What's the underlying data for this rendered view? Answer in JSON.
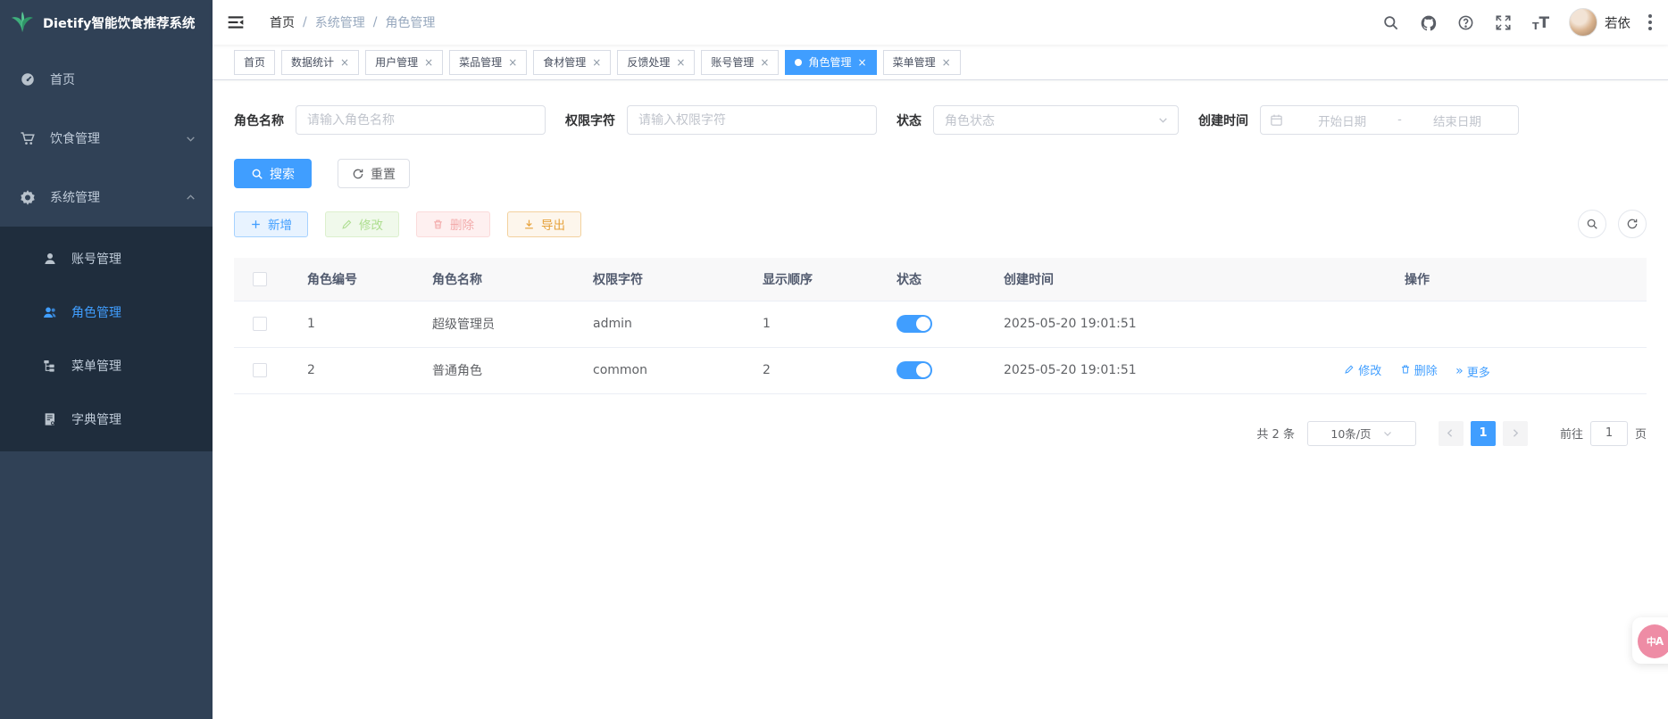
{
  "app": {
    "title": "Dietify智能饮食推荐系统",
    "user_name": "若依"
  },
  "sidebar": {
    "items": [
      {
        "label": "首页"
      },
      {
        "label": "饮食管理"
      },
      {
        "label": "系统管理"
      }
    ],
    "submenu": [
      {
        "label": "账号管理"
      },
      {
        "label": "角色管理"
      },
      {
        "label": "菜单管理"
      },
      {
        "label": "字典管理"
      }
    ]
  },
  "breadcrumb": {
    "items": [
      "首页",
      "系统管理",
      "角色管理"
    ],
    "separator": "/"
  },
  "tabs": [
    {
      "label": "首页",
      "closable": false,
      "active": false
    },
    {
      "label": "数据统计",
      "closable": true,
      "active": false
    },
    {
      "label": "用户管理",
      "closable": true,
      "active": false
    },
    {
      "label": "菜品管理",
      "closable": true,
      "active": false
    },
    {
      "label": "食材管理",
      "closable": true,
      "active": false
    },
    {
      "label": "反馈处理",
      "closable": true,
      "active": false
    },
    {
      "label": "账号管理",
      "closable": true,
      "active": false
    },
    {
      "label": "角色管理",
      "closable": true,
      "active": true
    },
    {
      "label": "菜单管理",
      "closable": true,
      "active": false
    }
  ],
  "ui": {
    "close_glyph": "×",
    "date_separator": "-",
    "prev_glyph": "‹",
    "next_glyph": "›",
    "more_glyph": "»"
  },
  "filters": {
    "role_name": {
      "label": "角色名称",
      "placeholder": "请输入角色名称",
      "value": ""
    },
    "perm_key": {
      "label": "权限字符",
      "placeholder": "请输入权限字符",
      "value": ""
    },
    "status": {
      "label": "状态",
      "placeholder": "角色状态"
    },
    "create_time": {
      "label": "创建时间",
      "start_placeholder": "开始日期",
      "end_placeholder": "结束日期"
    }
  },
  "actions": {
    "search": "搜索",
    "reset": "重置",
    "add": "新增",
    "edit": "修改",
    "delete": "删除",
    "export": "导出"
  },
  "table": {
    "headers": [
      "角色编号",
      "角色名称",
      "权限字符",
      "显示顺序",
      "状态",
      "创建时间",
      "操作"
    ],
    "rows": [
      {
        "id": "1",
        "name": "超级管理员",
        "key": "admin",
        "order": "1",
        "status_on": true,
        "created": "2025-05-20 19:01:51"
      },
      {
        "id": "2",
        "name": "普通角色",
        "key": "common",
        "order": "2",
        "status_on": true,
        "created": "2025-05-20 19:01:51"
      }
    ]
  },
  "row_ops": {
    "edit": "修改",
    "delete": "删除",
    "more": "更多"
  },
  "pagination": {
    "total": "共 2 条",
    "page_size": "10条/页",
    "page": "1",
    "goto_label": "前往",
    "goto_value": "1",
    "unit": "页"
  },
  "colors": {
    "primary": "#409eff",
    "sidebar_bg": "#304156",
    "submenu_bg": "#1f2d3d",
    "active_tab": "#409eff",
    "export_orange": "#e6a23c",
    "float_pink": "#ee8ca5"
  }
}
